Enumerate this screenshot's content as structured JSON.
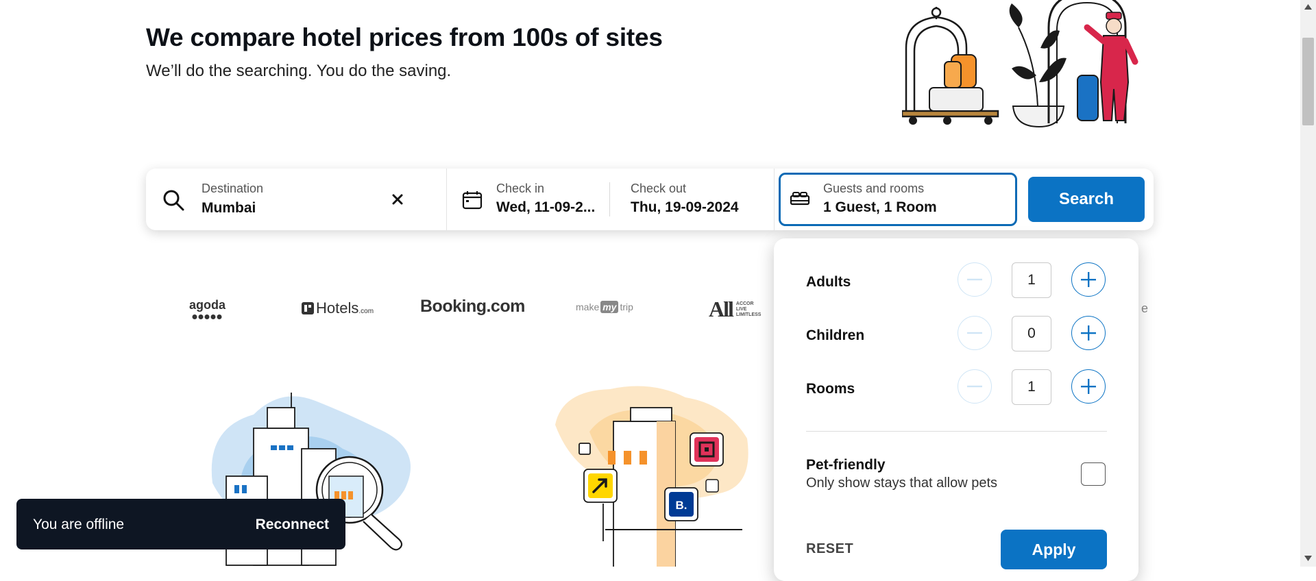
{
  "header": {
    "title": "We compare hotel prices from 100s of sites",
    "subtitle": "We’ll do the searching. You do the saving."
  },
  "search": {
    "destination_label": "Destination",
    "destination_value": "Mumbai",
    "checkin_label": "Check in",
    "checkin_value": "Wed, 11-09-2...",
    "checkout_label": "Check out",
    "checkout_value": "Thu, 19-09-2024",
    "guests_label": "Guests and rooms",
    "guests_value": "1 Guest, 1 Room",
    "search_button": "Search"
  },
  "partners": {
    "agoda": "agoda",
    "hotels": "Hotels",
    "hotels_suffix": ".com",
    "booking": "Booking.com",
    "mmt_left": "make",
    "mmt_mid": "my",
    "mmt_right": "trip",
    "accor_big": "All",
    "accor_l1": "ACCOR",
    "accor_l2": "LIVE",
    "accor_l3": "LIMITLESS",
    "cut_letter": "e"
  },
  "guests_popup": {
    "rows": [
      {
        "label": "Adults",
        "value": "1"
      },
      {
        "label": "Children",
        "value": "0"
      },
      {
        "label": "Rooms",
        "value": "1"
      }
    ],
    "pet_title": "Pet-friendly",
    "pet_desc": "Only show stays that allow pets",
    "pet_checked": false,
    "reset_label": "RESET",
    "apply_label": "Apply"
  },
  "illustration2": {
    "badge_b": "B."
  },
  "toast": {
    "message": "You are offline",
    "action": "Reconnect"
  },
  "colors": {
    "accent": "#0b73c4",
    "toast_bg": "#0e1623"
  }
}
